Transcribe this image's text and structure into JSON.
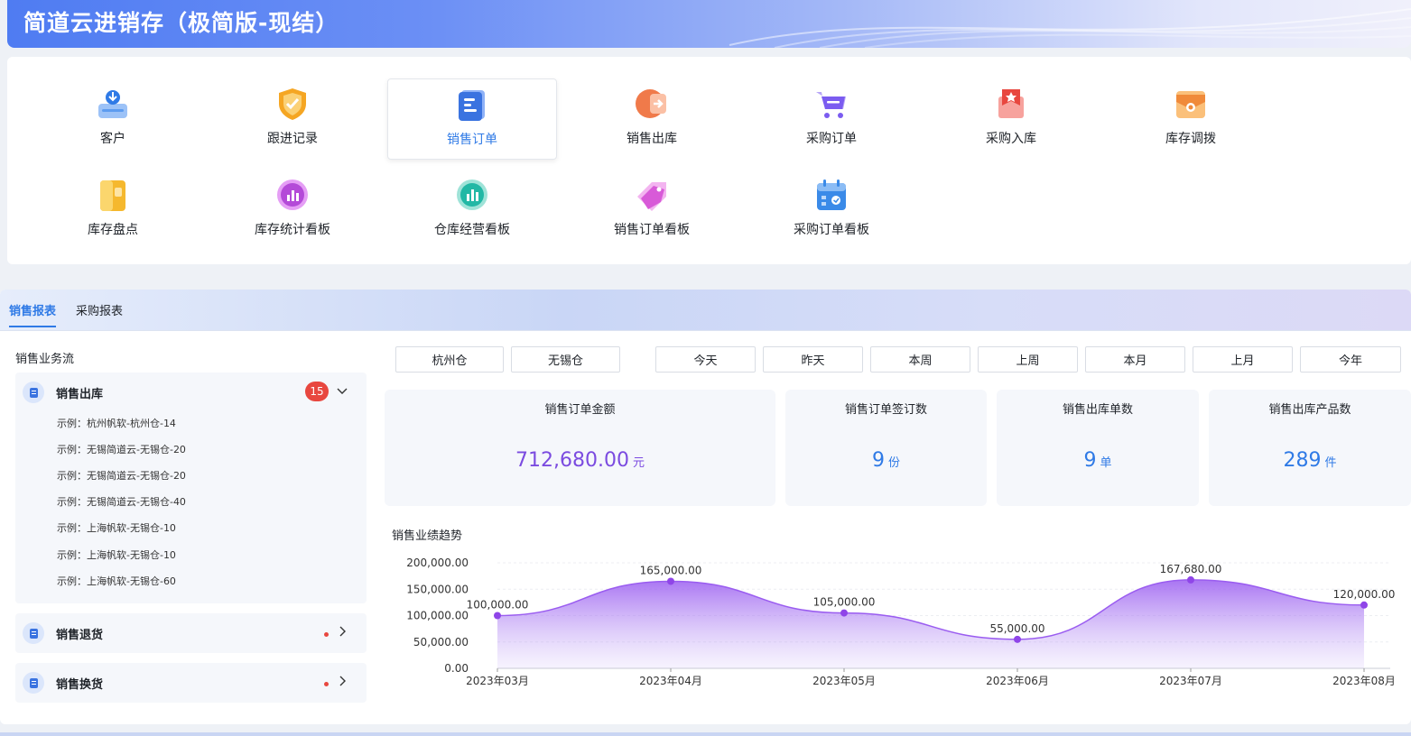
{
  "header": {
    "title": "简道云进销存（极简版-现结）"
  },
  "apps": [
    {
      "label": "客户",
      "icon": "customer-icon",
      "color": "#2f7ae6"
    },
    {
      "label": "跟进记录",
      "icon": "follow-up-shield-icon",
      "color": "#f5a623"
    },
    {
      "label": "销售订单",
      "icon": "sales-order-icon",
      "color": "#3a73e0",
      "active": true
    },
    {
      "label": "销售出库",
      "icon": "sales-outbound-icon",
      "color": "#f07a4a"
    },
    {
      "label": "采购订单",
      "icon": "purchase-cart-icon",
      "color": "#7b5cf0"
    },
    {
      "label": "采购入库",
      "icon": "purchase-inbound-icon",
      "color": "#e8473f"
    },
    {
      "label": "库存调拨",
      "icon": "inventory-transfer-icon",
      "color": "#f08a3a"
    },
    {
      "label": "库存盘点",
      "icon": "stocktake-icon",
      "color": "#f5b82e"
    },
    {
      "label": "库存统计看板",
      "icon": "inventory-dashboard-icon",
      "color": "#b44ad8"
    },
    {
      "label": "仓库经营看板",
      "icon": "warehouse-dashboard-icon",
      "color": "#22b8a5"
    },
    {
      "label": "销售订单看板",
      "icon": "sales-dashboard-tag-icon",
      "color": "#d85ad8"
    },
    {
      "label": "采购订单看板",
      "icon": "purchase-calendar-icon",
      "color": "#3a8ae8"
    }
  ],
  "tabs": [
    {
      "label": "销售报表",
      "active": true
    },
    {
      "label": "采购报表",
      "active": false
    }
  ],
  "flow": {
    "title": "销售业务流",
    "sections": [
      {
        "name": "销售出库",
        "badge": "15",
        "items": [
          "示例：杭州帆软-杭州仓-14",
          "示例：无锡简道云-无锡仓-20",
          "示例：无锡简道云-无锡仓-20",
          "示例：无锡简道云-无锡仓-40",
          "示例：上海帆软-无锡仓-10",
          "示例：上海帆软-无锡仓-10",
          "示例：上海帆软-无锡仓-60"
        ]
      },
      {
        "name": "销售退货"
      },
      {
        "name": "销售换货"
      }
    ]
  },
  "filters": {
    "warehouses": [
      "杭州仓",
      "无锡仓"
    ],
    "periods": [
      "今天",
      "昨天",
      "本周",
      "上周",
      "本月",
      "上月",
      "今年"
    ]
  },
  "stats": [
    {
      "title": "销售订单金额",
      "value": "712,680.00",
      "unit": "元",
      "color": "#7b4be0"
    },
    {
      "title": "销售订单签订数",
      "value": "9",
      "unit": "份",
      "color": "#2f7ae6"
    },
    {
      "title": "销售出库单数",
      "value": "9",
      "unit": "单",
      "color": "#2f7ae6"
    },
    {
      "title": "销售出库产品数",
      "value": "289",
      "unit": "件",
      "color": "#2f7ae6"
    }
  ],
  "trend_title": "销售业绩趋势",
  "chart_data": {
    "type": "area",
    "categories": [
      "2023年03月",
      "2023年04月",
      "2023年05月",
      "2023年06月",
      "2023年07月",
      "2023年08月"
    ],
    "values": [
      100000,
      165000,
      105000,
      55000,
      167680,
      120000
    ],
    "value_labels": [
      "100,000.00",
      "165,000.00",
      "105,000.00",
      "55,000.00",
      "167,680.00",
      "120,000.00"
    ],
    "yticks": [
      "0.00",
      "50,000.00",
      "100,000.00",
      "150,000.00",
      "200,000.00"
    ],
    "ylim": [
      0,
      200000
    ],
    "grid": true,
    "color": "#9a5cf0"
  }
}
